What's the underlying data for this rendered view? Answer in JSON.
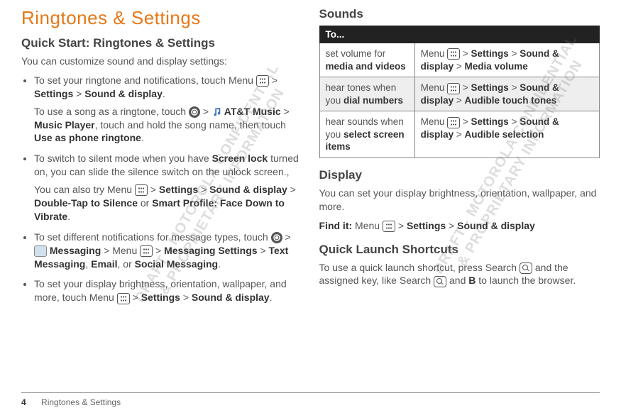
{
  "watermark": "DRAFT - MOTOROLA CONFIDENTIAL\n& PROPRIETARY INFORMATION",
  "left": {
    "title": "Ringtones & Settings",
    "quickstart_heading": "Quick Start: Ringtones & Settings",
    "intro": "You can customize sound and display settings:",
    "b1a": "To set your ringtone and notifications, touch Menu ",
    "b1b": " > ",
    "b1_settings": "Settings",
    "b1c": " > ",
    "b1_sd": "Sound & display",
    "b1d": ".",
    "b1_p2a": "To use a song as a ringtone, touch ",
    "b1_p2b": " > ",
    "b1_att": "AT&T Music",
    "b1_p2c": " > ",
    "b1_mp": "Music Player",
    "b1_p2d": ", touch and hold the song name, then touch ",
    "b1_use": "Use as phone ringtone",
    "b1_p2e": ".",
    "b2a": "To switch to silent mode when you have ",
    "b2_sl": "Screen lock",
    "b2b": " turned on, you can slide the silence switch on the unlock screen.,",
    "b2_p2a": "You can also try Menu ",
    "b2_p2b": " > ",
    "b2_settings": "Settings",
    "b2_p2c": " > ",
    "b2_sd": "Sound & display",
    "b2_p2d": " > ",
    "b2_dt": "Double-Tap to Silence",
    "b2_p2e": " or ",
    "b2_sp": "Smart Profile: Face Down to Vibrate",
    "b2_p2f": ".",
    "b3a": "To set different notifications for message types, touch ",
    "b3b": " > ",
    "b3_msg": "Messaging",
    "b3c": " > Menu ",
    "b3d": " > ",
    "b3_ms": "Messaging Settings",
    "b3e": " > ",
    "b3_tm": "Text Messaging",
    "b3f": ", ",
    "b3_em": "Email",
    "b3g": ", or ",
    "b3_sm": "Social Messaging",
    "b3h": ".",
    "b4a": "To set your display brightness, orientation, wallpaper, and more, touch Menu ",
    "b4b": " > ",
    "b4_settings": "Settings",
    "b4c": " > ",
    "b4_sd": "Sound & display",
    "b4d": "."
  },
  "right": {
    "sounds_heading": "Sounds",
    "th": "To...",
    "r1a1": "set volume for ",
    "r1a2": "media and videos",
    "r1b1": "Menu ",
    "r1b2": " > ",
    "r1b_settings": "Settings",
    "r1b3": " > ",
    "r1b_sd": "Sound & display",
    "r1b4": " > ",
    "r1b_mv": "Media volume",
    "r2a1": "hear tones when you ",
    "r2a2": "dial numbers",
    "r2b1": "Menu ",
    "r2b2": " > ",
    "r2b_settings": "Settings",
    "r2b3": " > ",
    "r2b_sd": "Sound & display",
    "r2b4": " > ",
    "r2b_att": "Audible touch tones",
    "r3a1": "hear sounds when you ",
    "r3a2": "select screen items",
    "r3b1": "Menu ",
    "r3b2": " > ",
    "r3b_settings": "Settings",
    "r3b3": " > ",
    "r3b_sd": "Sound & display",
    "r3b4": " > ",
    "r3b_as": "Audible selection",
    "display_heading": "Display",
    "display_body": "You can set your display brightness, orientation, wallpaper, and more.",
    "findit_a": "Find it:",
    "findit_b": " Menu ",
    "findit_c": " > ",
    "findit_settings": "Settings",
    "findit_d": " > ",
    "findit_sd": "Sound & display",
    "ql_heading": "Quick Launch Shortcuts",
    "ql_a": "To use a quick launch shortcut, press Search ",
    "ql_b": " and the assigned key, like Search ",
    "ql_c": " and ",
    "ql_B": "B",
    "ql_d": " to launch the browser."
  },
  "footer": {
    "page": "4",
    "section": "Ringtones & Settings"
  }
}
